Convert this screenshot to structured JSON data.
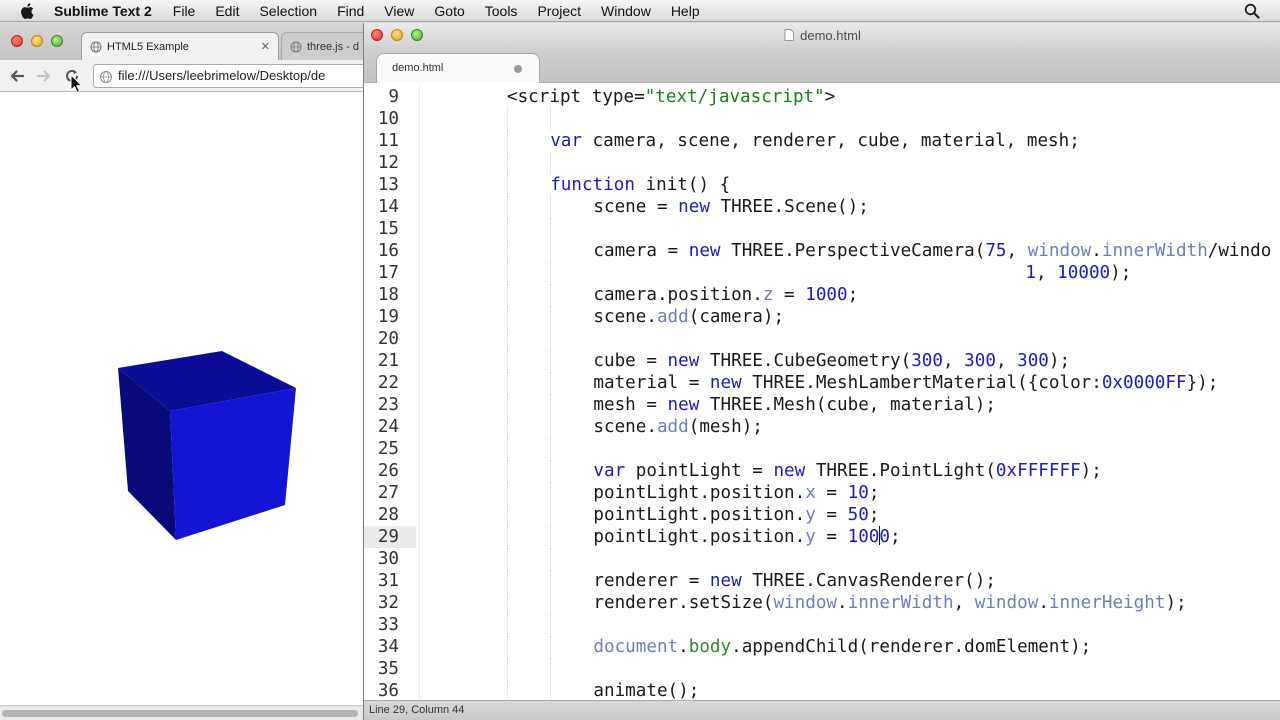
{
  "menubar": {
    "app_name": "Sublime Text 2",
    "items": [
      "File",
      "Edit",
      "Selection",
      "Find",
      "View",
      "Goto",
      "Tools",
      "Project",
      "Window",
      "Help"
    ]
  },
  "browser": {
    "tabs": [
      {
        "title": "HTML5 Example",
        "active": true
      },
      {
        "title": "three.js - d",
        "active": false
      }
    ],
    "address": "file:///Users/leebrimelow/Desktop/de",
    "cube_color": "#1212c8"
  },
  "sublime": {
    "window_title": "demo.html",
    "tab_label": "demo.html",
    "status": "Line 29, Column 44",
    "current_line": 29
  },
  "code_lines": [
    {
      "n": "9",
      "text": "<script type=\"text/javascript\">"
    },
    {
      "n": "10",
      "text": ""
    },
    {
      "n": "11",
      "text": "var camera, scene, renderer, cube, material, mesh;"
    },
    {
      "n": "12",
      "text": ""
    },
    {
      "n": "13",
      "text": "function init() {"
    },
    {
      "n": "14",
      "text": "scene = new THREE.Scene();"
    },
    {
      "n": "15",
      "text": ""
    },
    {
      "n": "16",
      "text": "camera = new THREE.PerspectiveCamera(75, window.innerWidth/windo"
    },
    {
      "n": "17",
      "text": "1, 10000);"
    },
    {
      "n": "18",
      "text": "camera.position.z = 1000;"
    },
    {
      "n": "19",
      "text": "scene.add(camera);"
    },
    {
      "n": "20",
      "text": ""
    },
    {
      "n": "21",
      "text": "cube = new THREE.CubeGeometry(300, 300, 300);"
    },
    {
      "n": "22",
      "text": "material = new THREE.MeshLambertMaterial({color:0x0000FF});"
    },
    {
      "n": "23",
      "text": "mesh = new THREE.Mesh(cube, material);"
    },
    {
      "n": "24",
      "text": "scene.add(mesh);"
    },
    {
      "n": "25",
      "text": ""
    },
    {
      "n": "26",
      "text": "var pointLight = new THREE.PointLight(0xFFFFFF);"
    },
    {
      "n": "27",
      "text": "pointLight.position.x = 10;"
    },
    {
      "n": "28",
      "text": "pointLight.position.y = 50;"
    },
    {
      "n": "29",
      "text": "pointLight.position.y = 1000;"
    },
    {
      "n": "30",
      "text": ""
    },
    {
      "n": "31",
      "text": "renderer = new THREE.CanvasRenderer();"
    },
    {
      "n": "32",
      "text": "renderer.setSize(window.innerWidth, window.innerHeight);"
    },
    {
      "n": "33",
      "text": ""
    },
    {
      "n": "34",
      "text": "document.body.appendChild(renderer.domElement);"
    },
    {
      "n": "35",
      "text": ""
    },
    {
      "n": "36",
      "text": "animate();"
    }
  ]
}
